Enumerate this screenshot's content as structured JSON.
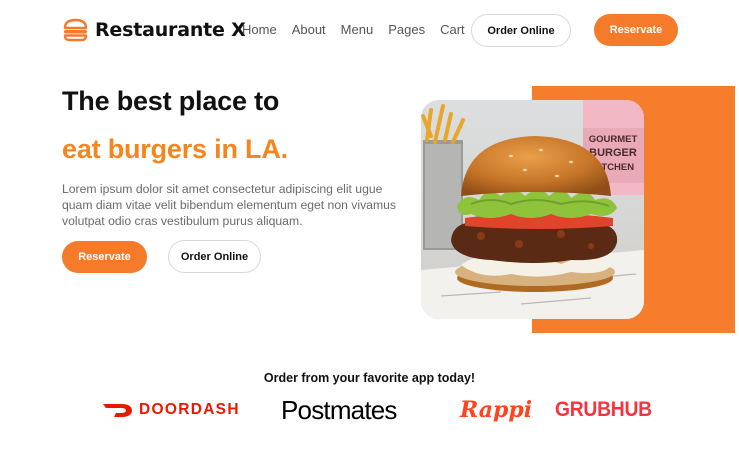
{
  "brand": {
    "name": "Restaurante X",
    "accent": "#f57a2a",
    "logo_icon": "burger-icon"
  },
  "nav": {
    "links": [
      "Home",
      "About",
      "Menu",
      "Pages",
      "Cart"
    ],
    "order_online_label": "Order Online",
    "reservate_label": "Reservate"
  },
  "hero": {
    "title_line1": "The best place to",
    "title_line2": "eat burgers in LA.",
    "description": "Lorem ipsum dolor sit amet consectetur adipiscing elit ugue quam diam vitae velit bibendum elementum eget non vivamus volutpat odio cras vestibulum purus aliquam.",
    "reservate_label": "Reservate",
    "order_online_label": "Order Online",
    "photo": {
      "cup_text_1": "GOURMET",
      "cup_text_2": "BURGER",
      "cup_text_3": "KITCHEN"
    }
  },
  "partners": {
    "title": "Order from your favorite app today!",
    "items": [
      {
        "name": "DOORDASH",
        "color": "#eb1700"
      },
      {
        "name": "Postmates",
        "color": "#000000"
      },
      {
        "name": "Rappi",
        "color": "#ff441f"
      },
      {
        "name": "GRUBHUB",
        "color": "#f63440"
      }
    ]
  }
}
